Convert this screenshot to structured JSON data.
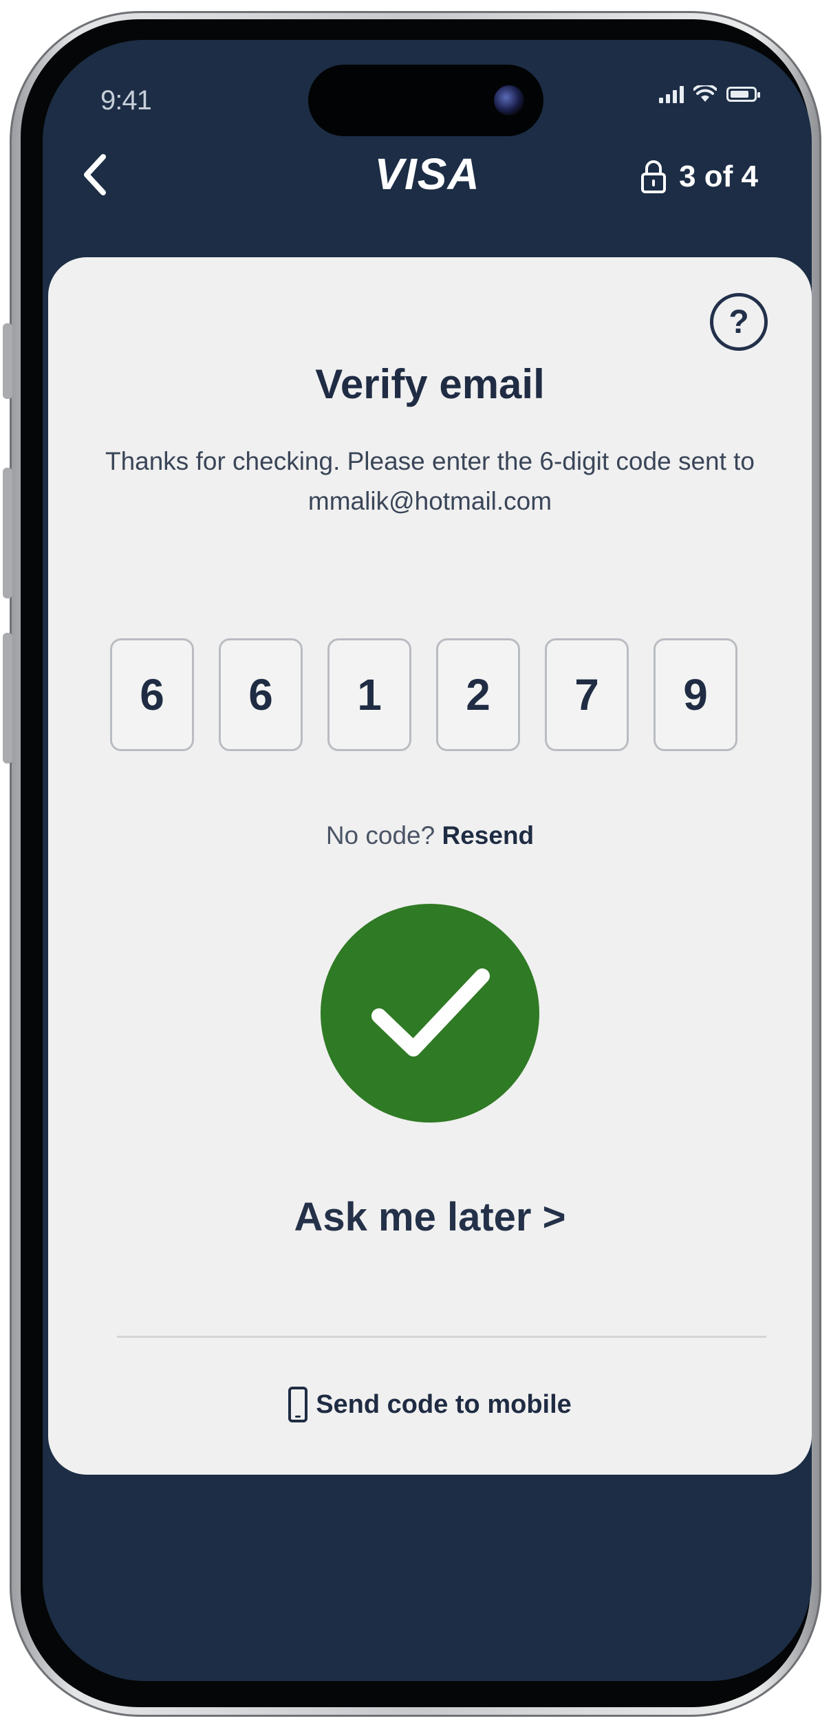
{
  "status_bar": {
    "time": "9:41"
  },
  "header": {
    "back_icon": "chevron-left-icon",
    "brand": "VISA",
    "step_icon": "lock-icon",
    "step": "3 of 4"
  },
  "card": {
    "help_label": "?",
    "title": "Verify email",
    "subtitle": "Thanks for checking. Please enter the 6-digit code sent to mmalik@hotmail.com",
    "code_digits": [
      "6",
      "6",
      "1",
      "2",
      "7",
      "9"
    ],
    "no_code_text": "No code?",
    "resend_label": "Resend",
    "success_icon": "checkmark-icon",
    "success_color": "#2f7a24",
    "ask_later_label": "Ask me later >",
    "send_mobile_icon": "mobile-phone-icon",
    "send_mobile_label": "Send code to mobile"
  },
  "colors": {
    "header_bg": "#1c2d45",
    "card_bg": "#f0f0f0",
    "text_dark": "#1f2c43"
  }
}
